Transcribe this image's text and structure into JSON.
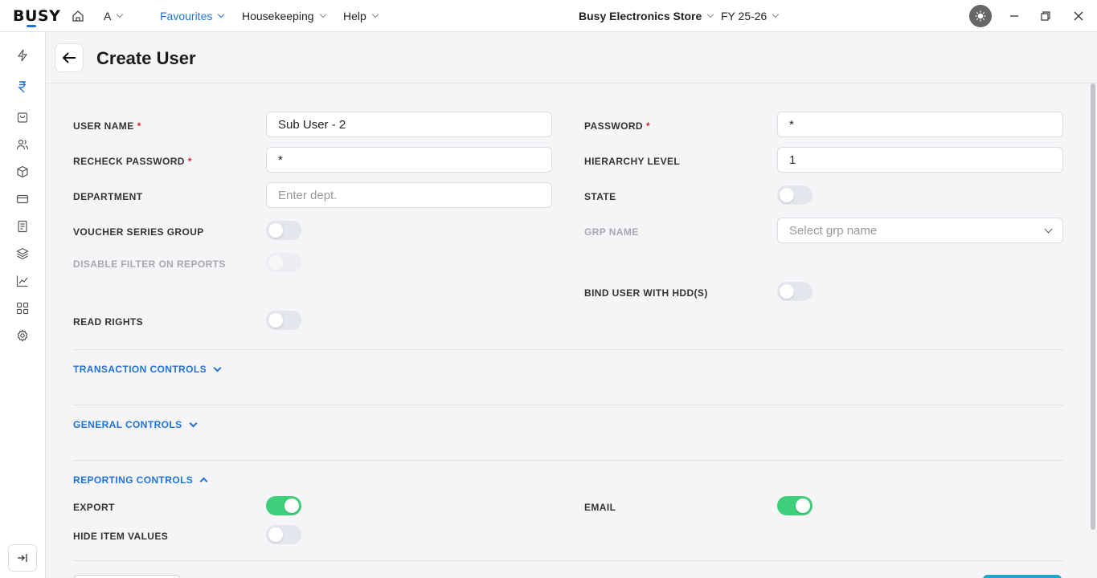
{
  "topbar": {
    "logo": "BUSY",
    "user_initial": "A",
    "menus": [
      "Favourites",
      "Housekeeping",
      "Help"
    ],
    "company": "Busy Electronics Store",
    "fy": "FY 25-26"
  },
  "sidebar": {
    "icons": [
      "lightning-icon",
      "rupee-icon",
      "shopping-bag-icon",
      "users-icon",
      "cube-icon",
      "card-icon",
      "document-icon",
      "layers-icon",
      "chart-icon",
      "grid-icon",
      "gear-icon"
    ]
  },
  "header": {
    "title": "Create User"
  },
  "form": {
    "user_name": {
      "label": "USER NAME",
      "value": "Sub User - 2"
    },
    "password": {
      "label": "PASSWORD",
      "value": "*"
    },
    "recheck_password": {
      "label": "RECHECK PASSWORD",
      "value": "*"
    },
    "hierarchy_level": {
      "label": "HIERARCHY LEVEL",
      "value": "1"
    },
    "department": {
      "label": "DEPARTMENT",
      "placeholder": "Enter dept."
    },
    "state": {
      "label": "STATE",
      "on": false
    },
    "voucher_series_group": {
      "label": "VOUCHER SERIES GROUP",
      "on": false
    },
    "grp_name": {
      "label": "GRP NAME",
      "placeholder": "Select grp name"
    },
    "disable_filter": {
      "label": "DISABLE FILTER ON REPORTS",
      "on": false
    },
    "bind_user_hdd": {
      "label": "BIND USER WITH HDD(S)",
      "on": false
    },
    "read_rights": {
      "label": "READ RIGHTS",
      "on": false
    }
  },
  "sections": {
    "transaction": "TRANSACTION CONTROLS",
    "general": "GENERAL CONTROLS",
    "reporting": "REPORTING CONTROLS"
  },
  "reporting": {
    "export": {
      "label": "EXPORT",
      "on": true
    },
    "email": {
      "label": "EMAIL",
      "on": true
    },
    "hide_item_values": {
      "label": "HIDE ITEM VALUES",
      "on": false
    }
  },
  "colors": {
    "accent": "#1e73d9",
    "toggle_on": "#3ecf7a",
    "required": "#d9252b"
  }
}
